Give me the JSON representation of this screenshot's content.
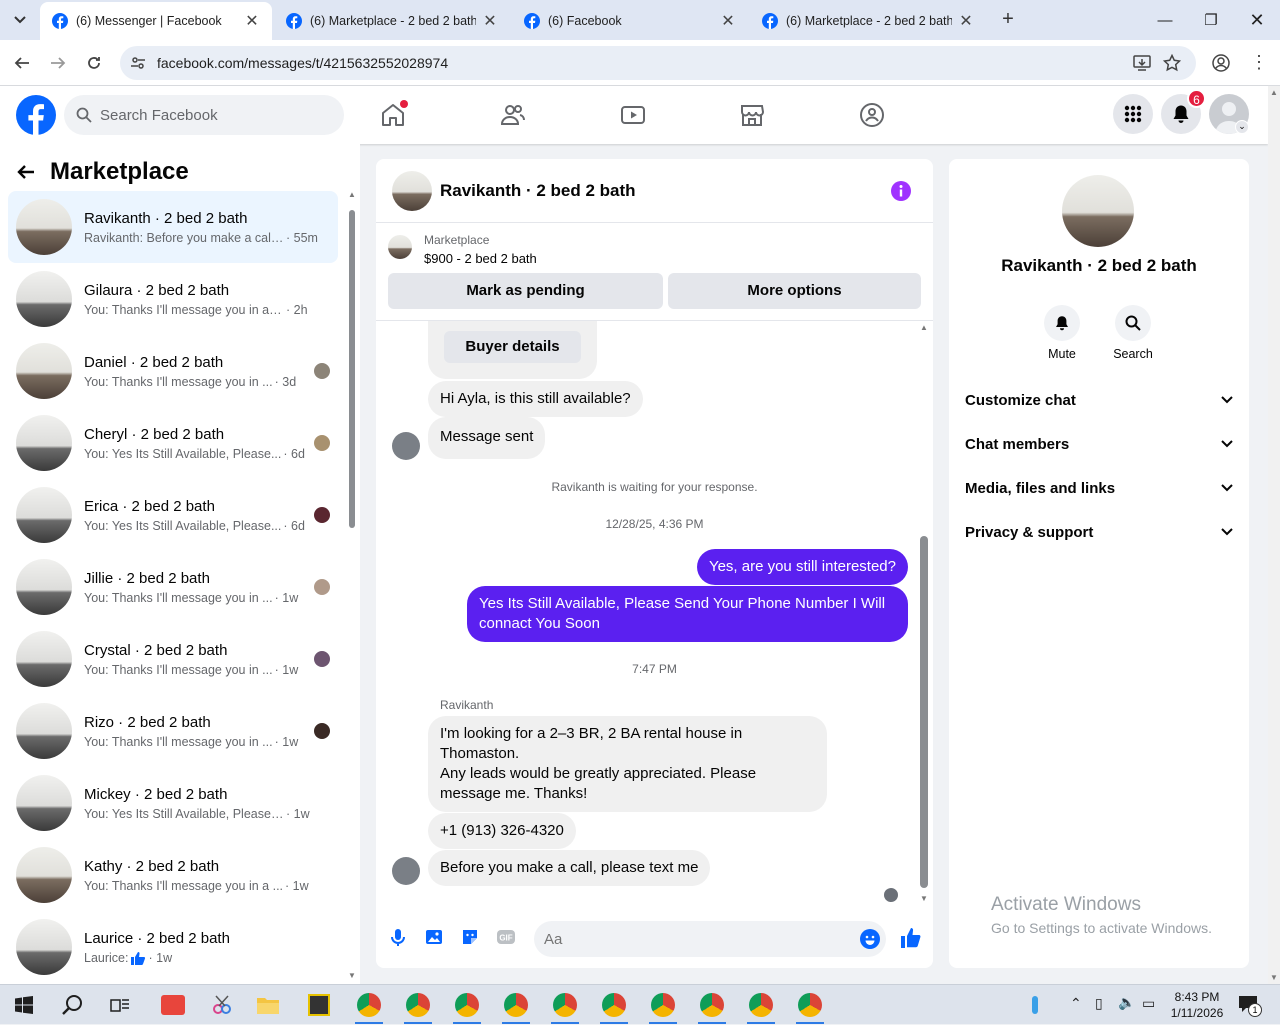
{
  "browser": {
    "tabs": [
      {
        "title": "(6) Messenger | Facebook",
        "active": true
      },
      {
        "title": "(6) Marketplace - 2 bed 2 bath |",
        "active": false
      },
      {
        "title": "(6) Facebook",
        "active": false
      },
      {
        "title": "(6) Marketplace - 2 bed 2 bath |",
        "active": false
      }
    ],
    "url": "facebook.com/messages/t/4215632552028974"
  },
  "fb": {
    "search_placeholder": "Search Facebook",
    "notification_count": "6"
  },
  "left": {
    "title": "Marketplace",
    "conversations": [
      {
        "name": "Ravikanth · 2 bed 2 bath",
        "preview": "Ravikanth: Before you make a call...",
        "time": "· 55m",
        "selected": true
      },
      {
        "name": "Gilaura · 2 bed 2 bath",
        "preview": "You: Thanks I'll message you in a m...",
        "time": "· 2h"
      },
      {
        "name": "Daniel · 2 bed 2 bath",
        "preview": "You: Thanks I'll message you in ...",
        "time": "· 3d"
      },
      {
        "name": "Cheryl · 2 bed 2 bath",
        "preview": "You: Yes Its Still Available, Please...",
        "time": "· 6d"
      },
      {
        "name": "Erica · 2 bed 2 bath",
        "preview": "You: Yes Its Still Available, Please...",
        "time": "· 6d"
      },
      {
        "name": "Jillie · 2 bed 2 bath",
        "preview": "You: Thanks I'll message you in ...",
        "time": "· 1w"
      },
      {
        "name": "Crystal · 2 bed 2 bath",
        "preview": "You: Thanks I'll message you in ...",
        "time": "· 1w"
      },
      {
        "name": "Rizo · 2 bed 2 bath",
        "preview": "You: Thanks I'll message you in ...",
        "time": "· 1w"
      },
      {
        "name": "Mickey · 2 bed 2 bath",
        "preview": "You: Yes Its Still Available, Please Se...",
        "time": "· 1w"
      },
      {
        "name": "Kathy · 2 bed 2 bath",
        "preview": "You: Thanks I'll message you in a ...",
        "time": "· 1w"
      },
      {
        "name": "Laurice · 2 bed 2 bath",
        "preview": "Laurice:",
        "time": "· 1w"
      }
    ]
  },
  "chat": {
    "title": "Ravikanth · 2 bed 2 bath",
    "marketplace_label": "Marketplace",
    "listing": "$900 - 2 bed 2 bath",
    "mark_pending": "Mark as pending",
    "more_options": "More options",
    "buyer_details": "Buyer details",
    "msg_available": "Hi Ayla, is this still available?",
    "msg_sent": "Message sent",
    "waiting": "Ravikanth is waiting for your response.",
    "date1": "12/28/25, 4:36 PM",
    "out1": "Yes, are you still interested?",
    "out2": "Yes Its Still Available, Please Send Your Phone Number I Will connact You Soon",
    "date2": "7:47 PM",
    "sender": "Ravikanth",
    "in1": "I'm looking for a 2–3 BR, 2 BA rental house in Thomaston.\nAny leads would be greatly appreciated. Please message me. Thanks!",
    "in2": "+1 (913) 326-4320",
    "in3": "Before you make a call, please text me",
    "composer_placeholder": "Aa"
  },
  "right": {
    "name": "Ravikanth · 2 bed 2 bath",
    "mute": "Mute",
    "search": "Search",
    "sections": [
      "Customize chat",
      "Chat members",
      "Media, files and links",
      "Privacy & support"
    ]
  },
  "watermark": {
    "line1": "Activate Windows",
    "line2": "Go to Settings to activate Windows."
  },
  "taskbar": {
    "time": "8:43 PM",
    "date": "1/11/2026",
    "notif_count": "1"
  },
  "colors": {
    "fb_blue": "#0866ff",
    "outgoing": "#5b20f0",
    "info_purple": "#a033ff"
  }
}
